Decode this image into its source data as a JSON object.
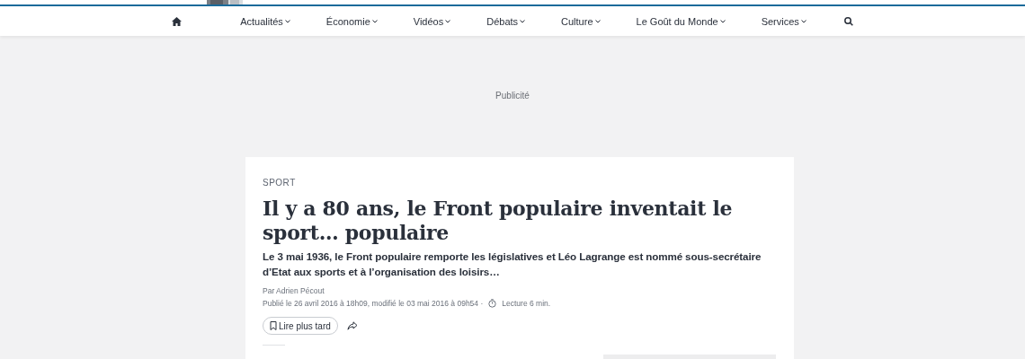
{
  "nav": {
    "items": [
      {
        "label": "Actualités"
      },
      {
        "label": "Économie"
      },
      {
        "label": "Vidéos"
      },
      {
        "label": "Débats"
      },
      {
        "label": "Culture"
      },
      {
        "label": "Le Goût du Monde"
      },
      {
        "label": "Services"
      }
    ]
  },
  "ad_label": "Publicité",
  "article": {
    "section": "SPORT",
    "title": "Il y a 80 ans, le Front populaire inventait le sport… populaire",
    "lead": "Le 3 mai 1936, le Front populaire remporte les législatives et Léo Lagrange est nommé sous-secrétaire d’Etat aux sports et à l’organisation des loisirs…",
    "author": "Par Adrien Pécout",
    "dates": "Publié le 26 avril 2016 à 18h09, modifié le 03 mai 2016 à 09h54 ·",
    "reading_time": "Lecture 6 min.",
    "save_button": "Lire plus tard"
  }
}
